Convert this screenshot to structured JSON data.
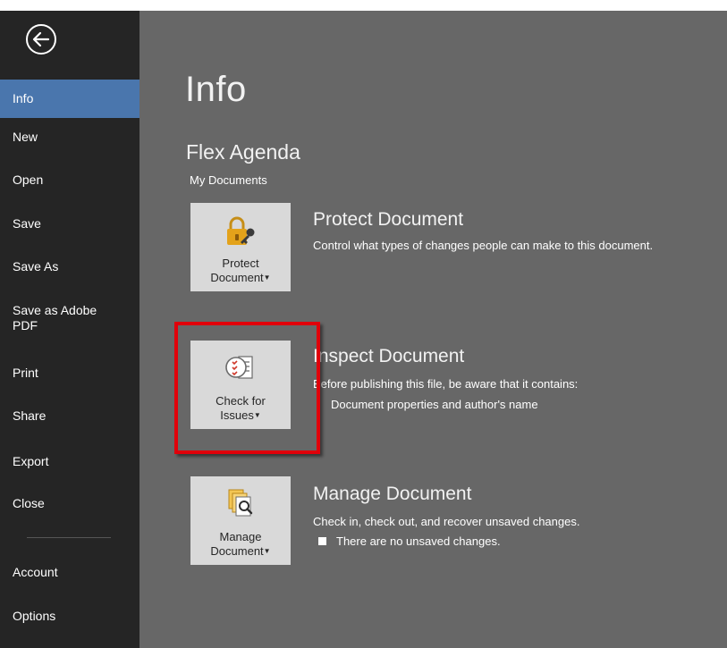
{
  "nav": {
    "items": [
      {
        "label": "Info"
      },
      {
        "label": "New"
      },
      {
        "label": "Open"
      },
      {
        "label": "Save"
      },
      {
        "label": "Save As"
      },
      {
        "label": "Save as Adobe PDF"
      },
      {
        "label": "Print"
      },
      {
        "label": "Share"
      },
      {
        "label": "Export"
      },
      {
        "label": "Close"
      },
      {
        "label": "Account"
      },
      {
        "label": "Options"
      }
    ],
    "active": "Info",
    "back_icon": "back-arrow-icon"
  },
  "main": {
    "title": "Info",
    "document_name": "Flex Agenda",
    "document_location": "My Documents",
    "sections": [
      {
        "button_line1": "Protect",
        "button_line2": "Document",
        "icon": "lock-key-icon",
        "heading": "Protect Document",
        "description": "Control what types of changes people can make to this document."
      },
      {
        "button_line1": "Check for",
        "button_line2": "Issues",
        "icon": "inspect-checklist-icon",
        "heading": "I​nspect Document",
        "description": "B​efore publishing this file, be aware that it contains:",
        "bullets": [
          "Document properties and author's name"
        ]
      },
      {
        "button_line1": "Manage",
        "button_line2": "Document",
        "icon": "manage-document-search-icon",
        "heading": "Manage Document",
        "description": "Check in, check out, and recover unsaved changes.",
        "bullets": [
          "There are no unsaved changes."
        ]
      }
    ]
  },
  "colors": {
    "sidebar": "#252525",
    "active_nav": "#4a76ad",
    "main_bg": "#676767",
    "tile_bg": "#d9d9d9",
    "highlight": "#e0000a"
  }
}
